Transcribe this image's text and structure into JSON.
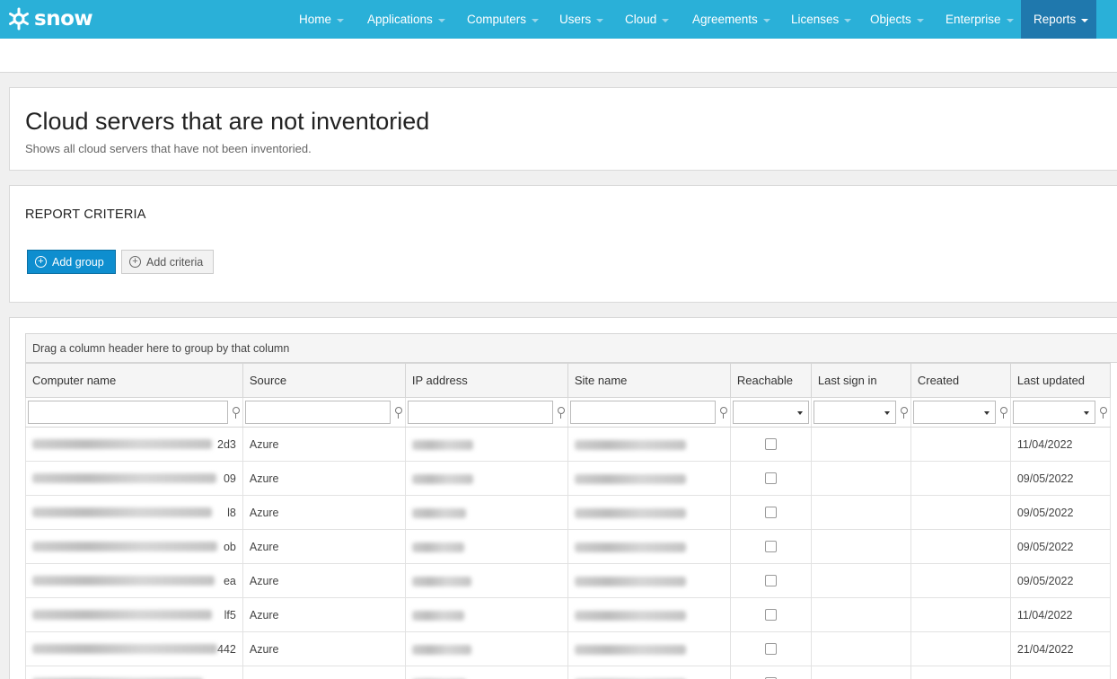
{
  "app": {
    "brand": "snow"
  },
  "nav": [
    {
      "label": "Home",
      "caret": true
    },
    {
      "label": "Applications",
      "caret": true
    },
    {
      "label": "Computers",
      "caret": true
    },
    {
      "label": "Users",
      "caret": true
    },
    {
      "label": "Cloud",
      "caret": true
    },
    {
      "label": "Agreements",
      "caret": true
    },
    {
      "label": "Licenses",
      "caret": true
    },
    {
      "label": "Objects",
      "caret": true
    },
    {
      "label": "Enterprise",
      "caret": true
    },
    {
      "label": "Reports",
      "caret": true,
      "active": true
    }
  ],
  "page": {
    "title": "Cloud servers that are not inventoried",
    "subtitle": "Shows all cloud servers that have not been inventoried."
  },
  "criteria": {
    "title": "REPORT CRITERIA",
    "add_group": "Add group",
    "add_criteria": "Add criteria"
  },
  "grid": {
    "group_hint": "Drag a column header here to group by that column",
    "columns": [
      "Computer name",
      "Source",
      "IP address",
      "Site name",
      "Reachable",
      "Last sign in",
      "Created",
      "Last updated"
    ],
    "rows": [
      {
        "name_suffix": "2d3",
        "source": "Azure",
        "reachable": false,
        "last_sign_in": "",
        "created": "",
        "last_updated": "11/04/2022"
      },
      {
        "name_suffix": "09",
        "source": "Azure",
        "reachable": false,
        "last_sign_in": "",
        "created": "",
        "last_updated": "09/05/2022"
      },
      {
        "name_suffix": "l8",
        "source": "Azure",
        "reachable": false,
        "last_sign_in": "",
        "created": "",
        "last_updated": "09/05/2022"
      },
      {
        "name_suffix": "ob",
        "source": "Azure",
        "reachable": false,
        "last_sign_in": "",
        "created": "",
        "last_updated": "09/05/2022"
      },
      {
        "name_suffix": "ea",
        "source": "Azure",
        "reachable": false,
        "last_sign_in": "",
        "created": "",
        "last_updated": "09/05/2022"
      },
      {
        "name_suffix": "lf5",
        "source": "Azure",
        "reachable": false,
        "last_sign_in": "",
        "created": "",
        "last_updated": "11/04/2022"
      },
      {
        "name_suffix": "442",
        "source": "Azure",
        "reachable": false,
        "last_sign_in": "",
        "created": "",
        "last_updated": "21/04/2022"
      },
      {
        "name_suffix": "",
        "source": "",
        "reachable": false,
        "last_sign_in": "",
        "created": "",
        "last_updated": ""
      }
    ]
  }
}
